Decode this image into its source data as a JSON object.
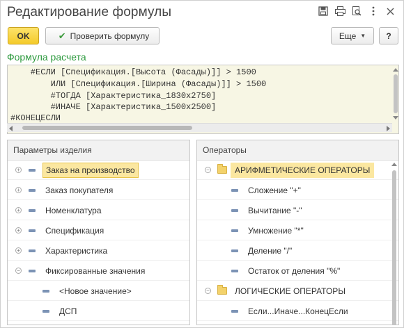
{
  "window": {
    "title": "Редактирование формулы"
  },
  "toolbar": {
    "ok_label": "OK",
    "check_label": "Проверить формулу",
    "more_label": "Еще",
    "help_label": "?"
  },
  "formula": {
    "label": "Формула расчета",
    "lines": [
      "    #ЕСЛИ [Спецификация.[Высота (Фасады)]] > 1500",
      "        ИЛИ [Спецификация.[Ширина (Фасады)]] > 1500",
      "        #ТОГДА [Характеристика_1830х2750]",
      "        #ИНАЧЕ [Характеристика_1500х2500]",
      "#КОНЕЦЕСЛИ"
    ]
  },
  "params_panel": {
    "header": "Параметры изделия",
    "items": [
      {
        "label": "Заказ на производство",
        "expander": "plus",
        "selected": true
      },
      {
        "label": "Заказ покупателя",
        "expander": "plus"
      },
      {
        "label": "Номенклатура",
        "expander": "plus"
      },
      {
        "label": "Спецификация",
        "expander": "plus"
      },
      {
        "label": "Характеристика",
        "expander": "plus"
      },
      {
        "label": "Фиксированные значения",
        "expander": "minus"
      },
      {
        "label": "<Новое значение>",
        "child": true
      },
      {
        "label": "ДСП",
        "child": true
      }
    ]
  },
  "operators_panel": {
    "header": "Операторы",
    "items": [
      {
        "label": "АРИФМЕТИЧЕСКИЕ ОПЕРАТОРЫ",
        "folder": true,
        "selected": true
      },
      {
        "label": "Сложение \"+\""
      },
      {
        "label": "Вычитание \"-\""
      },
      {
        "label": "Умножение \"*\""
      },
      {
        "label": "Деление \"/\""
      },
      {
        "label": "Остаток от деления \"%\""
      },
      {
        "label": "ЛОГИЧЕСКИЕ ОПЕРАТОРЫ",
        "folder": true
      },
      {
        "label": "Если...Иначе...КонецЕсли"
      }
    ]
  },
  "icons": {
    "save": "save-icon",
    "print": "print-icon",
    "preview": "preview-icon",
    "more": "more-vertical-icon",
    "close": "close-icon"
  },
  "colors": {
    "accent_green": "#2d9a3e",
    "ok_yellow": "#f4ca2a",
    "selection": "#fbe7a0",
    "formula_bg": "#f7f6e4"
  }
}
